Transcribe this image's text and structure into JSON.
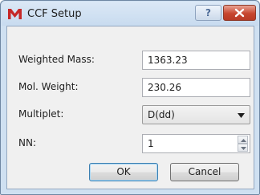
{
  "window": {
    "title": "CCF Setup",
    "help_label": "?"
  },
  "form": {
    "weighted_mass": {
      "label": "Weighted Mass:",
      "value": "1363.23"
    },
    "mol_weight": {
      "label": "Mol. Weight:",
      "value": "230.26"
    },
    "multiplet": {
      "label": "Multiplet:",
      "value": "D(dd)"
    },
    "nn": {
      "label": "NN:",
      "value": "1"
    }
  },
  "buttons": {
    "ok": "OK",
    "cancel": "Cancel"
  },
  "icons": {
    "app": "app-logo-icon",
    "help": "help-icon",
    "close": "close-icon",
    "dropdown": "chevron-down-icon",
    "spin_up": "spin-up-icon",
    "spin_down": "spin-down-icon"
  },
  "colors": {
    "title_bar": "#cfe0f1",
    "close_button": "#c7462f",
    "app_icon": "#c62828",
    "default_button_border": "#3c7fb1"
  }
}
